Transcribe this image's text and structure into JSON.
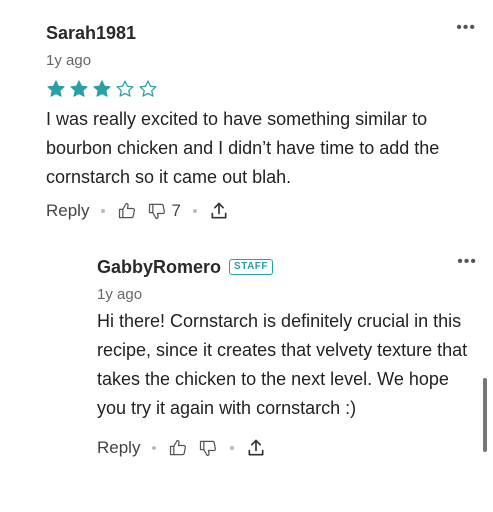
{
  "colors": {
    "accent": "#2a9fa6",
    "text": "#222222",
    "muted": "#666666"
  },
  "comments": [
    {
      "author": "Sarah1981",
      "time": "1y ago",
      "rating": 3,
      "rating_max": 5,
      "body": "I was really excited to have something similar to bourbon chicken and I didn’t have time to add the cornstarch so it came out blah.",
      "reply_label": "Reply",
      "dislike_count": "7"
    },
    {
      "author": "GabbyRomero",
      "badge": "STAFF",
      "time": "1y ago",
      "body": "Hi there! Cornstarch is definitely crucial in this recipe, since it creates that velvety texture that takes the chicken to the next level. We hope you try it again with cornstarch :)",
      "reply_label": "Reply"
    }
  ],
  "icons": [
    "more-icon",
    "star-icon",
    "thumbs-up-icon",
    "thumbs-down-icon",
    "share-icon"
  ]
}
